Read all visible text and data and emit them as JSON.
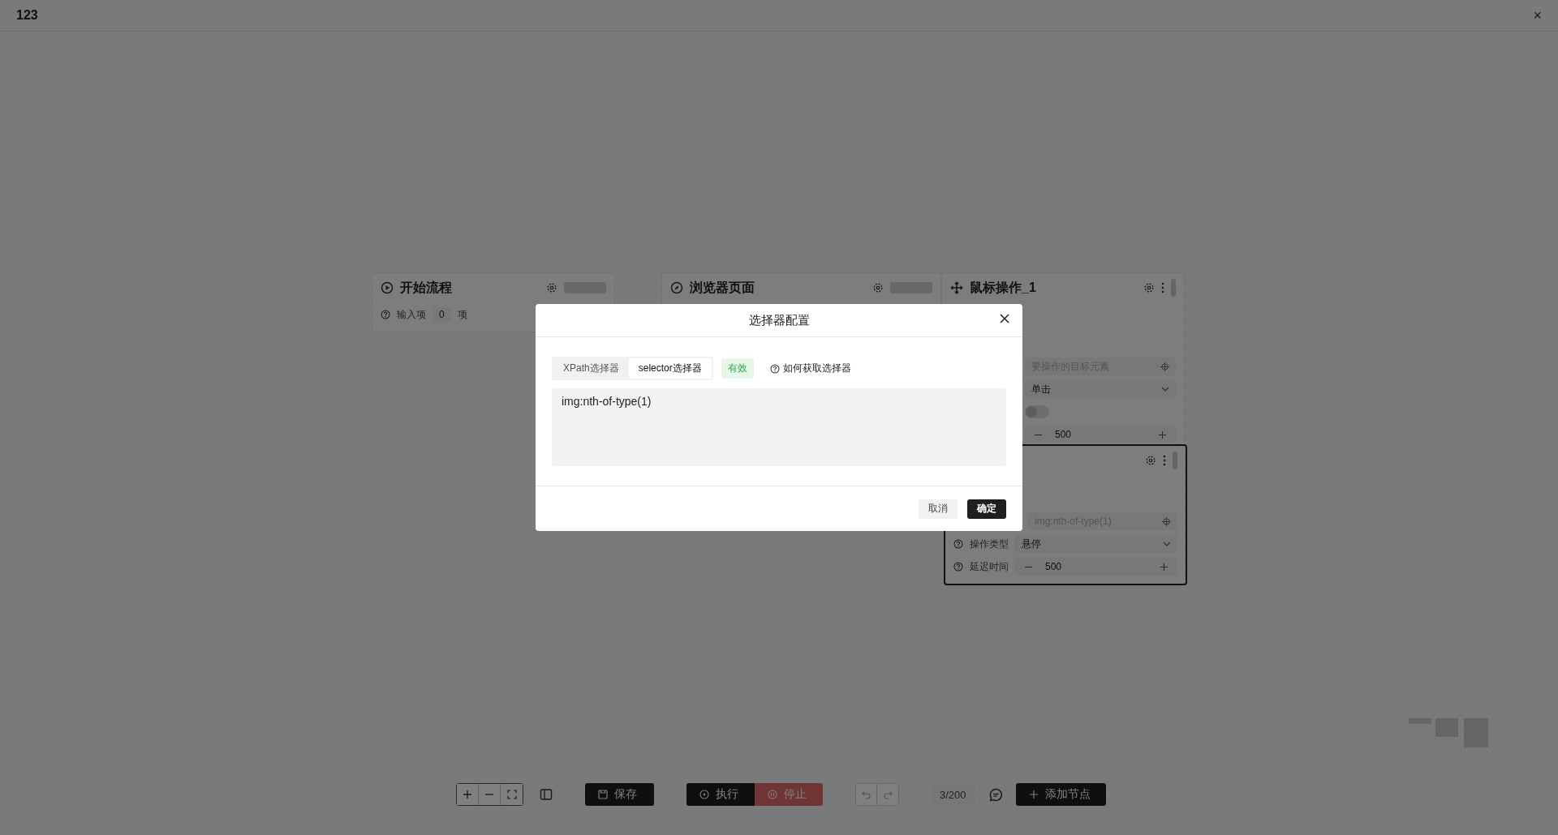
{
  "window": {
    "title": "123",
    "close": "×"
  },
  "nodes": [
    {
      "title": "开始流程",
      "kind": "start",
      "selected": false,
      "fields": [
        {
          "kind": "count",
          "label": "输入项",
          "value": "0",
          "unit": "项"
        }
      ]
    },
    {
      "title": "浏览器页面",
      "kind": "page",
      "selected": false
    },
    {
      "title": "鼠标操作_1",
      "kind": "mouse",
      "selected": false,
      "fields": [
        {
          "kind": "target",
          "placeholder": "要操作的目标元素"
        },
        {
          "kind": "select",
          "value": "单击"
        },
        {
          "kind": "switch",
          "on": false
        },
        {
          "kind": "stepper",
          "value": "500"
        }
      ]
    },
    {
      "kind": "mouse",
      "selected": true,
      "fields": [
        {
          "kind": "target",
          "placeholder": "img:nth-of-type(1)"
        },
        {
          "kind": "select",
          "label": "操作类型",
          "value": "悬停"
        },
        {
          "kind": "stepper",
          "label": "延迟时间",
          "value": "500"
        }
      ]
    }
  ],
  "toolbar": {
    "save": "保存",
    "run": "执行",
    "stop": {
      "label": "停止",
      "disabled": true
    },
    "counter": "3/200",
    "add": "添加节点"
  },
  "dialog": {
    "title": "选择器配置",
    "tabs": [
      {
        "label": "XPath选择器",
        "selected": false
      },
      {
        "label": "selector选择器",
        "selected": true
      }
    ],
    "status": "有效",
    "help": "如何获取选择器",
    "value": "img:nth-of-type(1)",
    "buttons": [
      {
        "label": "取消",
        "kind": "secondary"
      },
      {
        "label": "确定",
        "kind": "primary"
      }
    ]
  }
}
